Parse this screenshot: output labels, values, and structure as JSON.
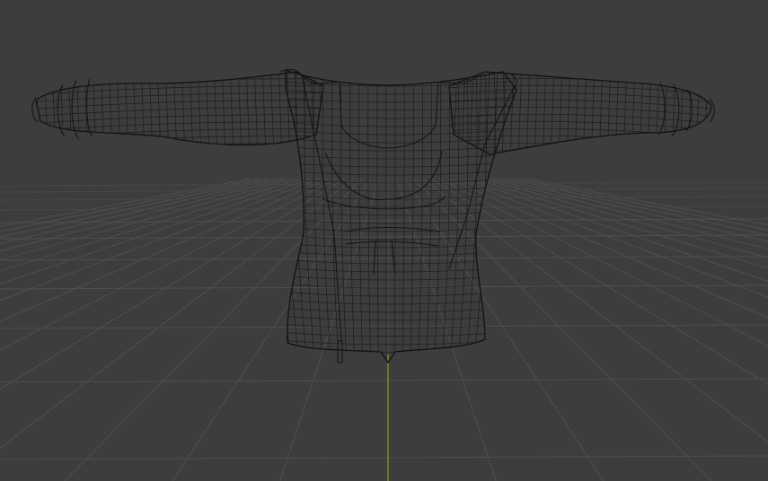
{
  "viewport": {
    "background": "#3d3d3d",
    "grid_color": "#4f4f4f",
    "axis_y_color": "#6f9a24",
    "wire_color": "#1c1c1c",
    "shading": "wireframe"
  },
  "scene": {
    "object": "hoodie-and-top-mesh",
    "axis": "y-axis"
  }
}
